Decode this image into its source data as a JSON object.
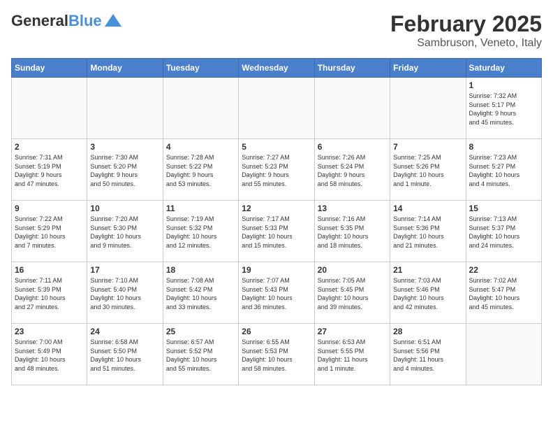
{
  "header": {
    "logo_line1": "General",
    "logo_line2": "Blue",
    "month": "February 2025",
    "location": "Sambruson, Veneto, Italy"
  },
  "weekdays": [
    "Sunday",
    "Monday",
    "Tuesday",
    "Wednesday",
    "Thursday",
    "Friday",
    "Saturday"
  ],
  "weeks": [
    [
      {
        "day": "",
        "info": ""
      },
      {
        "day": "",
        "info": ""
      },
      {
        "day": "",
        "info": ""
      },
      {
        "day": "",
        "info": ""
      },
      {
        "day": "",
        "info": ""
      },
      {
        "day": "",
        "info": ""
      },
      {
        "day": "1",
        "info": "Sunrise: 7:32 AM\nSunset: 5:17 PM\nDaylight: 9 hours\nand 45 minutes."
      }
    ],
    [
      {
        "day": "2",
        "info": "Sunrise: 7:31 AM\nSunset: 5:19 PM\nDaylight: 9 hours\nand 47 minutes."
      },
      {
        "day": "3",
        "info": "Sunrise: 7:30 AM\nSunset: 5:20 PM\nDaylight: 9 hours\nand 50 minutes."
      },
      {
        "day": "4",
        "info": "Sunrise: 7:28 AM\nSunset: 5:22 PM\nDaylight: 9 hours\nand 53 minutes."
      },
      {
        "day": "5",
        "info": "Sunrise: 7:27 AM\nSunset: 5:23 PM\nDaylight: 9 hours\nand 55 minutes."
      },
      {
        "day": "6",
        "info": "Sunrise: 7:26 AM\nSunset: 5:24 PM\nDaylight: 9 hours\nand 58 minutes."
      },
      {
        "day": "7",
        "info": "Sunrise: 7:25 AM\nSunset: 5:26 PM\nDaylight: 10 hours\nand 1 minute."
      },
      {
        "day": "8",
        "info": "Sunrise: 7:23 AM\nSunset: 5:27 PM\nDaylight: 10 hours\nand 4 minutes."
      }
    ],
    [
      {
        "day": "9",
        "info": "Sunrise: 7:22 AM\nSunset: 5:29 PM\nDaylight: 10 hours\nand 7 minutes."
      },
      {
        "day": "10",
        "info": "Sunrise: 7:20 AM\nSunset: 5:30 PM\nDaylight: 10 hours\nand 9 minutes."
      },
      {
        "day": "11",
        "info": "Sunrise: 7:19 AM\nSunset: 5:32 PM\nDaylight: 10 hours\nand 12 minutes."
      },
      {
        "day": "12",
        "info": "Sunrise: 7:17 AM\nSunset: 5:33 PM\nDaylight: 10 hours\nand 15 minutes."
      },
      {
        "day": "13",
        "info": "Sunrise: 7:16 AM\nSunset: 5:35 PM\nDaylight: 10 hours\nand 18 minutes."
      },
      {
        "day": "14",
        "info": "Sunrise: 7:14 AM\nSunset: 5:36 PM\nDaylight: 10 hours\nand 21 minutes."
      },
      {
        "day": "15",
        "info": "Sunrise: 7:13 AM\nSunset: 5:37 PM\nDaylight: 10 hours\nand 24 minutes."
      }
    ],
    [
      {
        "day": "16",
        "info": "Sunrise: 7:11 AM\nSunset: 5:39 PM\nDaylight: 10 hours\nand 27 minutes."
      },
      {
        "day": "17",
        "info": "Sunrise: 7:10 AM\nSunset: 5:40 PM\nDaylight: 10 hours\nand 30 minutes."
      },
      {
        "day": "18",
        "info": "Sunrise: 7:08 AM\nSunset: 5:42 PM\nDaylight: 10 hours\nand 33 minutes."
      },
      {
        "day": "19",
        "info": "Sunrise: 7:07 AM\nSunset: 5:43 PM\nDaylight: 10 hours\nand 36 minutes."
      },
      {
        "day": "20",
        "info": "Sunrise: 7:05 AM\nSunset: 5:45 PM\nDaylight: 10 hours\nand 39 minutes."
      },
      {
        "day": "21",
        "info": "Sunrise: 7:03 AM\nSunset: 5:46 PM\nDaylight: 10 hours\nand 42 minutes."
      },
      {
        "day": "22",
        "info": "Sunrise: 7:02 AM\nSunset: 5:47 PM\nDaylight: 10 hours\nand 45 minutes."
      }
    ],
    [
      {
        "day": "23",
        "info": "Sunrise: 7:00 AM\nSunset: 5:49 PM\nDaylight: 10 hours\nand 48 minutes."
      },
      {
        "day": "24",
        "info": "Sunrise: 6:58 AM\nSunset: 5:50 PM\nDaylight: 10 hours\nand 51 minutes."
      },
      {
        "day": "25",
        "info": "Sunrise: 6:57 AM\nSunset: 5:52 PM\nDaylight: 10 hours\nand 55 minutes."
      },
      {
        "day": "26",
        "info": "Sunrise: 6:55 AM\nSunset: 5:53 PM\nDaylight: 10 hours\nand 58 minutes."
      },
      {
        "day": "27",
        "info": "Sunrise: 6:53 AM\nSunset: 5:55 PM\nDaylight: 11 hours\nand 1 minute."
      },
      {
        "day": "28",
        "info": "Sunrise: 6:51 AM\nSunset: 5:56 PM\nDaylight: 11 hours\nand 4 minutes."
      },
      {
        "day": "",
        "info": ""
      }
    ]
  ]
}
